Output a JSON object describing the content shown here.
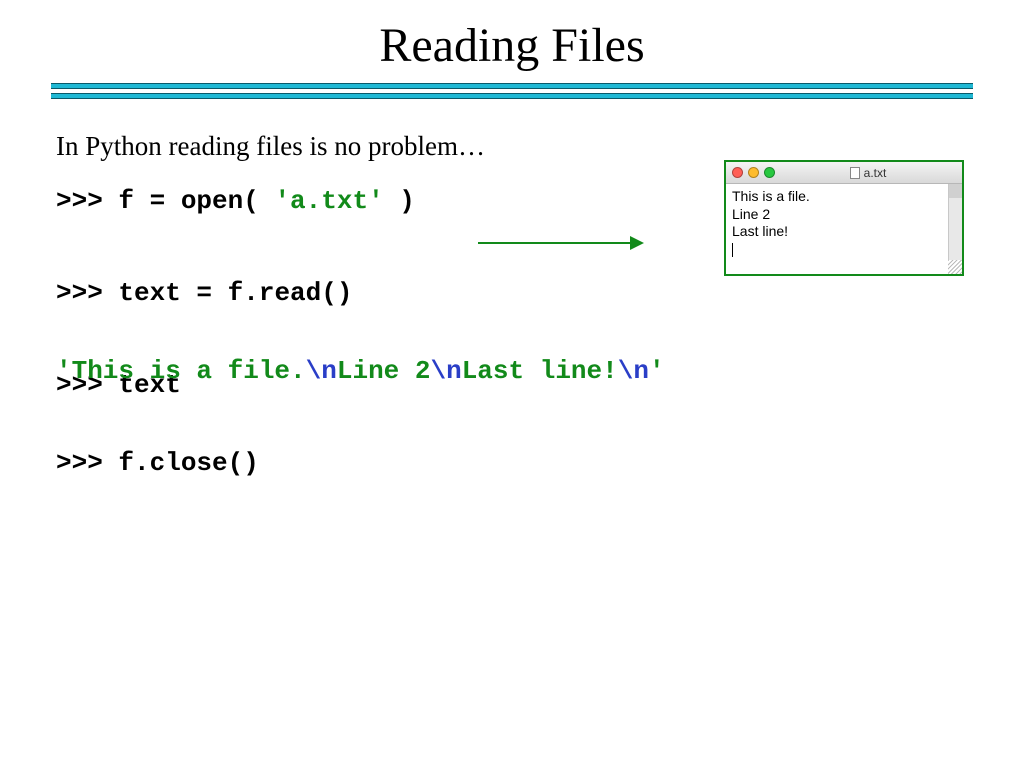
{
  "title": "Reading Files",
  "intro": "In Python reading files is no problem…",
  "code": {
    "line1_prompt": ">>> ",
    "line1_rest_a": "f = open( ",
    "line1_str": "'a.txt'",
    "line1_rest_b": " )",
    "line2_prompt": ">>> ",
    "line2_rest": "text = f.read()",
    "line3_prompt": ">>> ",
    "line3_rest": "text",
    "line4_prompt": ">>> ",
    "line4_rest": "f.close()"
  },
  "output": {
    "seg1": "'This is a file.",
    "esc1": "\\n",
    "seg2": "Line 2",
    "esc2": "\\n",
    "seg3": "Last line!",
    "esc3": "\\n",
    "seg4": "'"
  },
  "file_window": {
    "filename": "a.txt",
    "lines": [
      "This is a file.",
      "Line 2",
      "Last line!"
    ]
  }
}
